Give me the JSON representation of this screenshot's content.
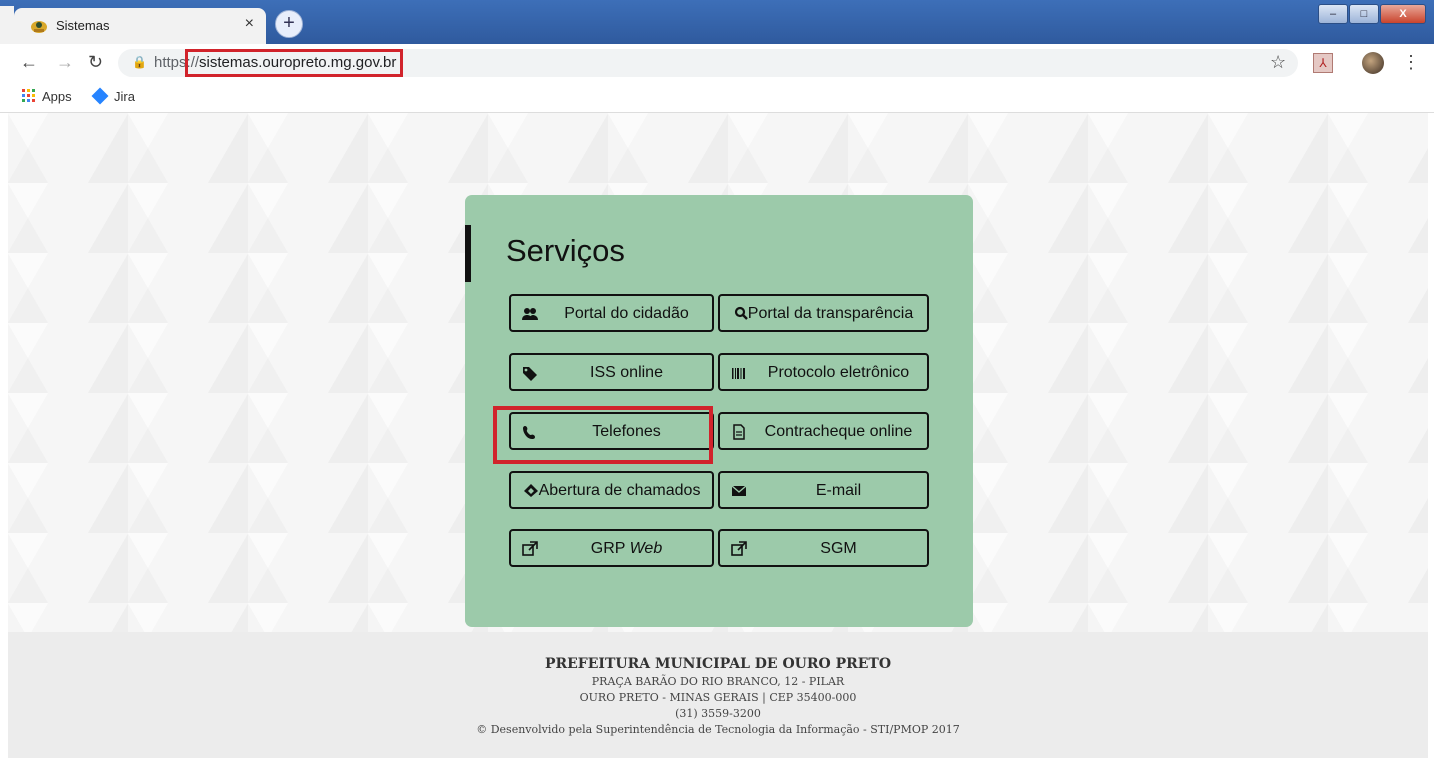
{
  "browser": {
    "tab_title": "Sistemas",
    "tab_close": "×",
    "new_tab": "+",
    "url_prefix": "http",
    "url_highlight": "sistemas.ouropreto.mg.gov.br",
    "url_prefix_full": "https://",
    "window_controls": {
      "minimize": "–",
      "maximize": "□",
      "close": "X"
    }
  },
  "bookmarks": {
    "apps": "Apps",
    "jira": "Jira"
  },
  "page": {
    "section_title": "Serviços",
    "buttons": [
      {
        "label": "Portal do cidadão",
        "icon": "users-icon"
      },
      {
        "label": "Portal da transparência",
        "icon": "search-icon"
      },
      {
        "label": "ISS online",
        "icon": "tags-icon"
      },
      {
        "label": "Protocolo eletrônico",
        "icon": "barcode-icon"
      },
      {
        "label": "Telefones",
        "icon": "phone-icon"
      },
      {
        "label": "Contracheque online",
        "icon": "document-icon"
      },
      {
        "label": "Abertura de chamados",
        "icon": "ticket-icon"
      },
      {
        "label": "E-mail",
        "icon": "envelope-icon"
      },
      {
        "label": "GRP",
        "label_em": "Web",
        "icon": "external-link-icon"
      },
      {
        "label": "SGM",
        "icon": "external-link-icon"
      }
    ],
    "highlight_color": "#d1232b",
    "card_color": "#9ccaaa"
  },
  "footer": {
    "org": "PREFEITURA MUNICIPAL DE OURO PRETO",
    "address": "PRAÇA BARÃO DO RIO BRANCO, 12 - PILAR",
    "city": "OURO PRETO - MINAS GERAIS | CEP 35400-000",
    "phone": "(31) 3559-3200",
    "credits": "© Desenvolvido pela Superintendência de Tecnologia da Informação - STI/PMOP 2017"
  }
}
